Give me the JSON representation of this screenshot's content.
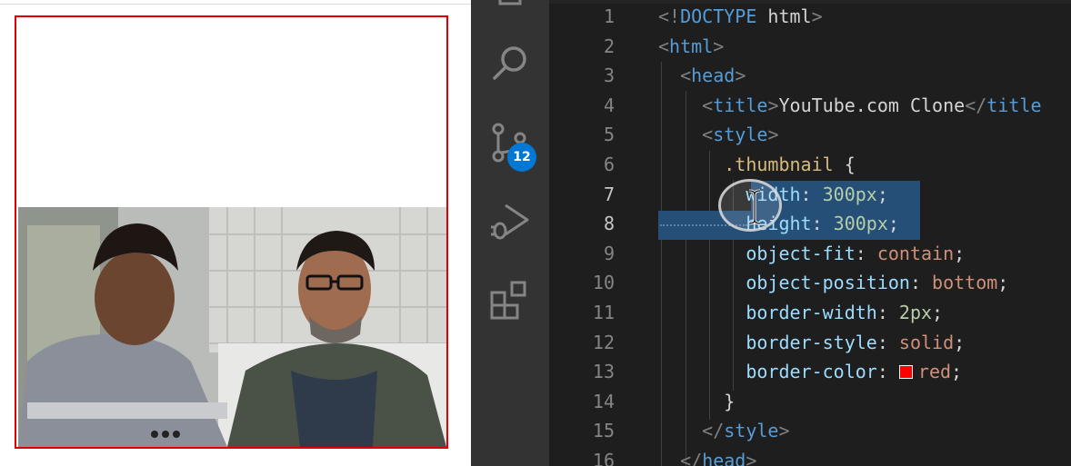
{
  "preview": {
    "thumbnail_alt": "thumbnail",
    "border_color": "#e00000"
  },
  "activity_bar": {
    "icons": [
      "explorer-icon",
      "search-icon",
      "source-control-icon",
      "run-debug-icon",
      "extensions-icon"
    ],
    "source_control_badge": "12",
    "badge_color": "#0078d4"
  },
  "editor": {
    "active_lines": [
      "7",
      "8"
    ],
    "lines": [
      {
        "n": "1",
        "parts": [
          [
            "punc",
            "<!"
          ],
          [
            "tag",
            "DOCTYPE"
          ],
          [
            "text",
            " html"
          ],
          [
            "punc",
            ">"
          ]
        ]
      },
      {
        "n": "2",
        "parts": [
          [
            "punc",
            "<"
          ],
          [
            "tag",
            "html"
          ],
          [
            "punc",
            ">"
          ]
        ]
      },
      {
        "n": "3",
        "parts": [
          [
            "text",
            "  "
          ],
          [
            "punc",
            "<"
          ],
          [
            "tag",
            "head"
          ],
          [
            "punc",
            ">"
          ]
        ]
      },
      {
        "n": "4",
        "parts": [
          [
            "text",
            "    "
          ],
          [
            "punc",
            "<"
          ],
          [
            "tag",
            "title"
          ],
          [
            "punc",
            ">"
          ],
          [
            "text",
            "YouTube.com Clone"
          ],
          [
            "punc",
            "</"
          ],
          [
            "tag",
            "title"
          ]
        ]
      },
      {
        "n": "5",
        "parts": [
          [
            "text",
            "    "
          ],
          [
            "punc",
            "<"
          ],
          [
            "tag",
            "style"
          ],
          [
            "punc",
            ">"
          ]
        ]
      },
      {
        "n": "6",
        "parts": [
          [
            "text",
            "      "
          ],
          [
            "sel",
            ".thumbnail"
          ],
          [
            "text",
            " {"
          ]
        ]
      },
      {
        "n": "7",
        "parts": [
          [
            "text",
            "        "
          ],
          [
            "prop",
            "width"
          ],
          [
            "text",
            ": "
          ],
          [
            "num",
            "300px"
          ],
          [
            "text",
            ";"
          ]
        ]
      },
      {
        "n": "8",
        "parts": [
          [
            "text",
            "        "
          ],
          [
            "prop",
            "height"
          ],
          [
            "text",
            ": "
          ],
          [
            "num",
            "300px"
          ],
          [
            "text",
            ";"
          ]
        ]
      },
      {
        "n": "9",
        "parts": [
          [
            "text",
            "        "
          ],
          [
            "prop",
            "object-fit"
          ],
          [
            "text",
            ": "
          ],
          [
            "val",
            "contain"
          ],
          [
            "text",
            ";"
          ]
        ]
      },
      {
        "n": "10",
        "parts": [
          [
            "text",
            "        "
          ],
          [
            "prop",
            "object-position"
          ],
          [
            "text",
            ": "
          ],
          [
            "val",
            "bottom"
          ],
          [
            "text",
            ";"
          ]
        ]
      },
      {
        "n": "11",
        "parts": [
          [
            "text",
            "        "
          ],
          [
            "prop",
            "border-width"
          ],
          [
            "text",
            ": "
          ],
          [
            "num",
            "2px"
          ],
          [
            "text",
            ";"
          ]
        ]
      },
      {
        "n": "12",
        "parts": [
          [
            "text",
            "        "
          ],
          [
            "prop",
            "border-style"
          ],
          [
            "text",
            ": "
          ],
          [
            "val",
            "solid"
          ],
          [
            "text",
            ";"
          ]
        ]
      },
      {
        "n": "13",
        "parts": [
          [
            "text",
            "        "
          ],
          [
            "prop",
            "border-color"
          ],
          [
            "text",
            ": "
          ],
          [
            "swatch",
            ""
          ],
          [
            "val",
            "red"
          ],
          [
            "text",
            ";"
          ]
        ]
      },
      {
        "n": "14",
        "parts": [
          [
            "text",
            "      }"
          ]
        ]
      },
      {
        "n": "15",
        "parts": [
          [
            "text",
            "    "
          ],
          [
            "punc",
            "</"
          ],
          [
            "tag",
            "style"
          ],
          [
            "punc",
            ">"
          ]
        ]
      },
      {
        "n": "16",
        "parts": [
          [
            "text",
            "  "
          ],
          [
            "punc",
            "</"
          ],
          [
            "tag",
            "head"
          ],
          [
            "punc",
            ">"
          ]
        ]
      }
    ]
  }
}
